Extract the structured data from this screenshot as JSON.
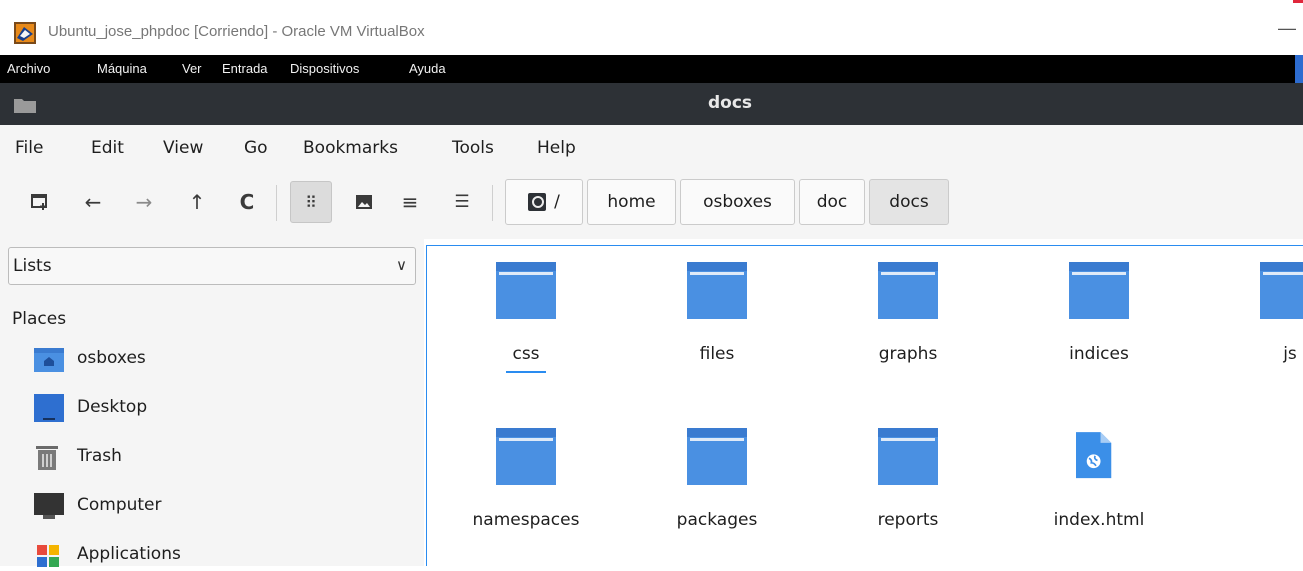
{
  "host_window": {
    "title": "Ubuntu_jose_phpdoc [Corriendo] - Oracle VM VirtualBox",
    "minimize_glyph": "—"
  },
  "vbox_menu": [
    "Archivo",
    "Máquina",
    "Ver",
    "Entrada",
    "Dispositivos",
    "Ayuda"
  ],
  "fm_window": {
    "title": "docs"
  },
  "menubar": [
    "File",
    "Edit",
    "View",
    "Go",
    "Bookmarks",
    "Tools",
    "Help"
  ],
  "toolbar": {
    "new_tab_icon": "new-tab-icon",
    "back_glyph": "←",
    "forward_glyph": "→",
    "up_glyph": "↑",
    "reload_glyph": "C",
    "icon_view_glyph": "⠿",
    "thumb_view_icon": "image-icon",
    "compact_view_glyph": "≡",
    "list_view_glyph": "☰"
  },
  "breadcrumb": {
    "root_label": "/",
    "segments": [
      "home",
      "osboxes",
      "doc",
      "docs"
    ]
  },
  "sidebar": {
    "lists_value": "Lists",
    "chevron": "∨",
    "places_heading": "Places",
    "items": [
      {
        "label": "osboxes",
        "icon": "home-folder-icon"
      },
      {
        "label": "Desktop",
        "icon": "desktop-icon"
      },
      {
        "label": "Trash",
        "icon": "trash-icon"
      },
      {
        "label": "Computer",
        "icon": "computer-icon"
      },
      {
        "label": "Applications",
        "icon": "applications-icon"
      }
    ]
  },
  "files": [
    {
      "name": "css",
      "type": "folder"
    },
    {
      "name": "files",
      "type": "folder"
    },
    {
      "name": "graphs",
      "type": "folder"
    },
    {
      "name": "indices",
      "type": "folder"
    },
    {
      "name": "js",
      "type": "folder"
    },
    {
      "name": "namespaces",
      "type": "folder"
    },
    {
      "name": "packages",
      "type": "folder"
    },
    {
      "name": "reports",
      "type": "folder"
    },
    {
      "name": "index.html",
      "type": "html"
    }
  ],
  "colors": {
    "folder": "#4a90e2",
    "folder_dark": "#3a7bd0",
    "accent": "#2a8cf0",
    "header_bg": "#2d3136"
  }
}
